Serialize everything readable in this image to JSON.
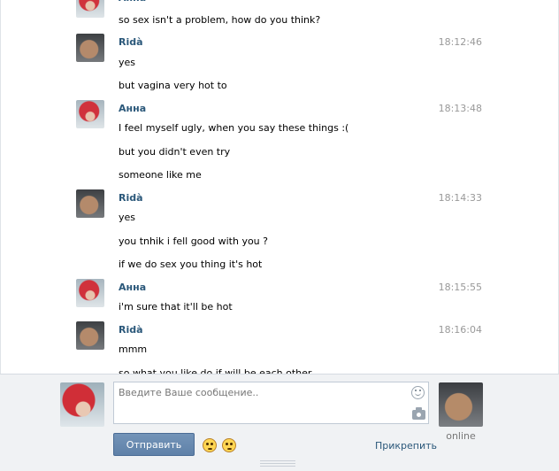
{
  "messages": [
    {
      "sender": "Анна",
      "sender_type": "anna",
      "time": "",
      "lines": [
        "so sex isn't a problem, how do you think?"
      ]
    },
    {
      "sender": "Ridà",
      "sender_type": "rida",
      "time": "18:12:46",
      "lines": [
        "yes",
        "but vagina very hot to"
      ]
    },
    {
      "sender": "Анна",
      "sender_type": "anna",
      "time": "18:13:48",
      "lines": [
        "I feel myself ugly, when you say these things :(",
        "but you didn't even try",
        "someone like me"
      ]
    },
    {
      "sender": "Ridà",
      "sender_type": "rida",
      "time": "18:14:33",
      "lines": [
        "yes",
        "you tnhik i fell good with you ?",
        "if we do sex you thing it's hot"
      ]
    },
    {
      "sender": "Анна",
      "sender_type": "anna",
      "time": "18:15:55",
      "lines": [
        "i'm sure that it'll be hot"
      ]
    },
    {
      "sender": "Ridà",
      "sender_type": "rida",
      "time": "18:16:04",
      "lines": [
        "mmm",
        "so what you like do if will be each other"
      ]
    }
  ],
  "composer": {
    "placeholder": "Введите Ваше сообщение..",
    "send_label": "Отправить",
    "attach_label": "Прикрепить",
    "peer_status": "online",
    "icons": [
      "smile-icon",
      "camera-icon",
      "emoji-sad-icon",
      "emoji-roll-eyes-icon"
    ]
  }
}
